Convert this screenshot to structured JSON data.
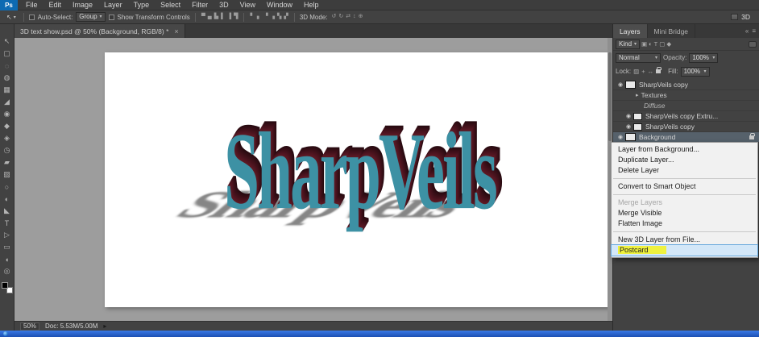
{
  "app": {
    "logo_text": "Ps"
  },
  "icons": {
    "caret_down": "▾",
    "close": "×",
    "eye": "◉",
    "disclosure": "▸",
    "panel_menu": "≡",
    "collapse_panels": "«",
    "flyout_arrow": "▸",
    "move_glyph": "↖"
  },
  "menubar": {
    "items": [
      {
        "label": "File",
        "name": "menu-file"
      },
      {
        "label": "Edit",
        "name": "menu-edit"
      },
      {
        "label": "Image",
        "name": "menu-image"
      },
      {
        "label": "Layer",
        "name": "menu-layer"
      },
      {
        "label": "Type",
        "name": "menu-type"
      },
      {
        "label": "Select",
        "name": "menu-select"
      },
      {
        "label": "Filter",
        "name": "menu-filter"
      },
      {
        "label": "3D",
        "name": "menu-3d"
      },
      {
        "label": "View",
        "name": "menu-view"
      },
      {
        "label": "Window",
        "name": "menu-window"
      },
      {
        "label": "Help",
        "name": "menu-help"
      }
    ]
  },
  "options_bar": {
    "auto_select_label": "Auto-Select:",
    "auto_select_value": "Group",
    "show_transform_label": "Show Transform Controls",
    "align_icons": [
      {
        "name": "align-top-edges-icon",
        "glyph": "▀"
      },
      {
        "name": "align-vertical-centers-icon",
        "glyph": "▄"
      },
      {
        "name": "align-bottom-edges-icon",
        "glyph": "▙"
      },
      {
        "name": "align-left-edges-icon",
        "glyph": "▌"
      },
      {
        "name": "align-horizontal-centers-icon",
        "glyph": "▐"
      },
      {
        "name": "align-right-edges-icon",
        "glyph": "▜"
      }
    ],
    "distribute_icons": [
      {
        "name": "distribute-top-edges-icon",
        "glyph": "▘"
      },
      {
        "name": "distribute-vertical-centers-icon",
        "glyph": "▖"
      },
      {
        "name": "distribute-bottom-edges-icon",
        "glyph": "▝"
      },
      {
        "name": "distribute-left-edges-icon",
        "glyph": "▗"
      },
      {
        "name": "distribute-horizontal-centers-icon",
        "glyph": "▚"
      },
      {
        "name": "distribute-right-edges-icon",
        "glyph": "▞"
      }
    ],
    "mode_label": "3D Mode:",
    "mode_icons": [
      {
        "name": "3d-rotate-camera-icon",
        "glyph": "↺"
      },
      {
        "name": "3d-roll-camera-icon",
        "glyph": "↻"
      },
      {
        "name": "3d-drag-camera-icon",
        "glyph": "⇄"
      },
      {
        "name": "3d-slide-camera-icon",
        "glyph": "↕"
      },
      {
        "name": "3d-zoom-camera-icon",
        "glyph": "⊕"
      }
    ],
    "workspace_label": "3D"
  },
  "document_tab": {
    "title": "3D text show.psd @ 50% (Background, RGB/8) *"
  },
  "toolbar": {
    "tools": [
      {
        "name": "move-tool",
        "glyph": "↖"
      },
      {
        "name": "rectangular-marquee-tool",
        "glyph": "▢"
      },
      {
        "name": "lasso-tool",
        "glyph": "◌"
      },
      {
        "name": "quick-selection-tool",
        "glyph": "◍"
      },
      {
        "name": "crop-tool",
        "glyph": "▦"
      },
      {
        "name": "eyedropper-tool",
        "glyph": "◢"
      },
      {
        "name": "spot-healing-brush-tool",
        "glyph": "◉"
      },
      {
        "name": "brush-tool",
        "glyph": "◆"
      },
      {
        "name": "clone-stamp-tool",
        "glyph": "◈"
      },
      {
        "name": "history-brush-tool",
        "glyph": "◷"
      },
      {
        "name": "eraser-tool",
        "glyph": "▰"
      },
      {
        "name": "gradient-tool",
        "glyph": "▨"
      },
      {
        "name": "blur-tool",
        "glyph": "○"
      },
      {
        "name": "dodge-tool",
        "glyph": "◐"
      },
      {
        "name": "pen-tool",
        "glyph": "◣"
      },
      {
        "name": "type-tool",
        "glyph": "T"
      },
      {
        "name": "path-selection-tool",
        "glyph": "▷"
      },
      {
        "name": "rectangle-tool",
        "glyph": "▭"
      },
      {
        "name": "hand-tool",
        "glyph": "◖"
      },
      {
        "name": "zoom-tool",
        "glyph": "◎"
      }
    ]
  },
  "canvas": {
    "artwork_text": "SharpVeils",
    "artwork_text_color": "#3d91a4",
    "artwork_extrude_color": "#45101a"
  },
  "layers_panel": {
    "tabs": [
      {
        "label": "Layers",
        "active": true,
        "name": "tab-layers"
      },
      {
        "label": "Mini Bridge",
        "name": "tab-mini-bridge"
      }
    ],
    "kind_label": "Kind",
    "filter_icons": [
      {
        "name": "filter-pixel-layers-icon",
        "glyph": "▣"
      },
      {
        "name": "filter-adjustment-layers-icon",
        "glyph": "◐"
      },
      {
        "name": "filter-type-layers-icon",
        "glyph": "T"
      },
      {
        "name": "filter-shape-layers-icon",
        "glyph": "▢"
      },
      {
        "name": "filter-smart-objects-icon",
        "glyph": "◆"
      }
    ],
    "blend_mode_value": "Normal",
    "opacity_label": "Opacity:",
    "opacity_value": "100%",
    "lock_label": "Lock:",
    "lock_icons": [
      {
        "name": "lock-transparency-icon",
        "glyph": "▨"
      },
      {
        "name": "lock-pixels-icon",
        "glyph": "+"
      },
      {
        "name": "lock-position-icon",
        "glyph": "↔"
      }
    ],
    "fill_label": "Fill:",
    "fill_value": "100%",
    "layers": [
      {
        "label": "SharpVeils copy",
        "type": "layer3d",
        "eye": true
      },
      {
        "label": "Textures",
        "type": "group"
      },
      {
        "label": "Diffuse",
        "type": "section"
      },
      {
        "label": "SharpVeils copy Extru...",
        "type": "texture",
        "eye": true
      },
      {
        "label": "SharpVeils copy",
        "type": "texture",
        "eye": true
      },
      {
        "label": "Background",
        "type": "background",
        "eye": true,
        "selected": true,
        "locked": true
      }
    ]
  },
  "context_menu": {
    "items": [
      {
        "label": "Layer from Background..."
      },
      {
        "label": "Duplicate Layer..."
      },
      {
        "label": "Delete Layer"
      },
      {
        "separator": true
      },
      {
        "label": "Convert to Smart Object"
      },
      {
        "separator": true
      },
      {
        "label": "Merge Layers",
        "state": "disabled",
        "interactable": false
      },
      {
        "label": "Merge Visible"
      },
      {
        "label": "Flatten Image"
      },
      {
        "separator": true
      },
      {
        "label": "New 3D Layer from File..."
      },
      {
        "label": "Postcard",
        "state": "highlighted",
        "highlight_color": "#eef13f"
      }
    ]
  },
  "status_bar": {
    "zoom": "50%",
    "doc_info": "Doc: 5.53M/5.00M"
  }
}
